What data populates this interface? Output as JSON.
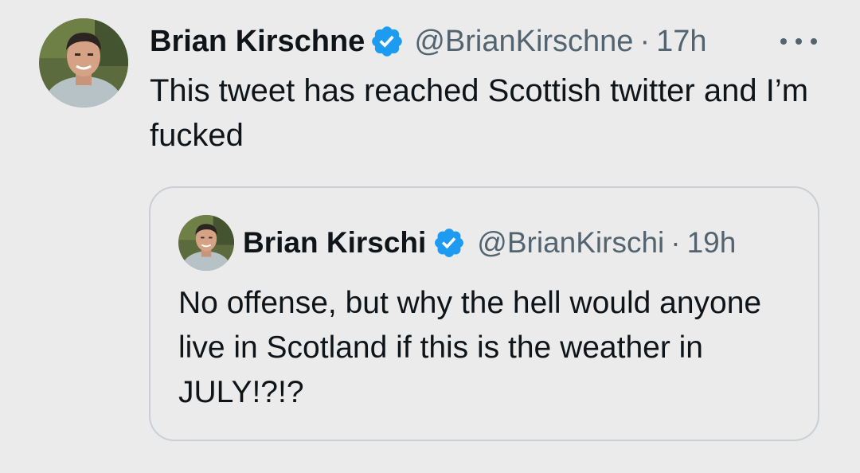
{
  "tweet": {
    "author_name": "Brian Kirschne",
    "handle": "@BrianKirschne",
    "separator": "·",
    "time": "17h",
    "text": "This tweet has reached Scottish twitter and I’m fucked",
    "verified_badge_color": "#1d9bf0",
    "icons": {
      "avatar": "avatar-photo",
      "verified": "verified-badge-icon",
      "more": "more-options-icon"
    }
  },
  "quoted_tweet": {
    "author_name": "Brian Kirschi",
    "handle": "@BrianKirschi",
    "separator": "·",
    "time": "19h",
    "text": "No offense, but why the hell would anyone live in Scotland if this is the weather in JULY!?!?",
    "verified_badge_color": "#1d9bf0"
  },
  "colors": {
    "background": "#ebebeb",
    "primary_text": "#0f1419",
    "secondary_text": "#536471",
    "quote_border": "#c9cfd4"
  }
}
